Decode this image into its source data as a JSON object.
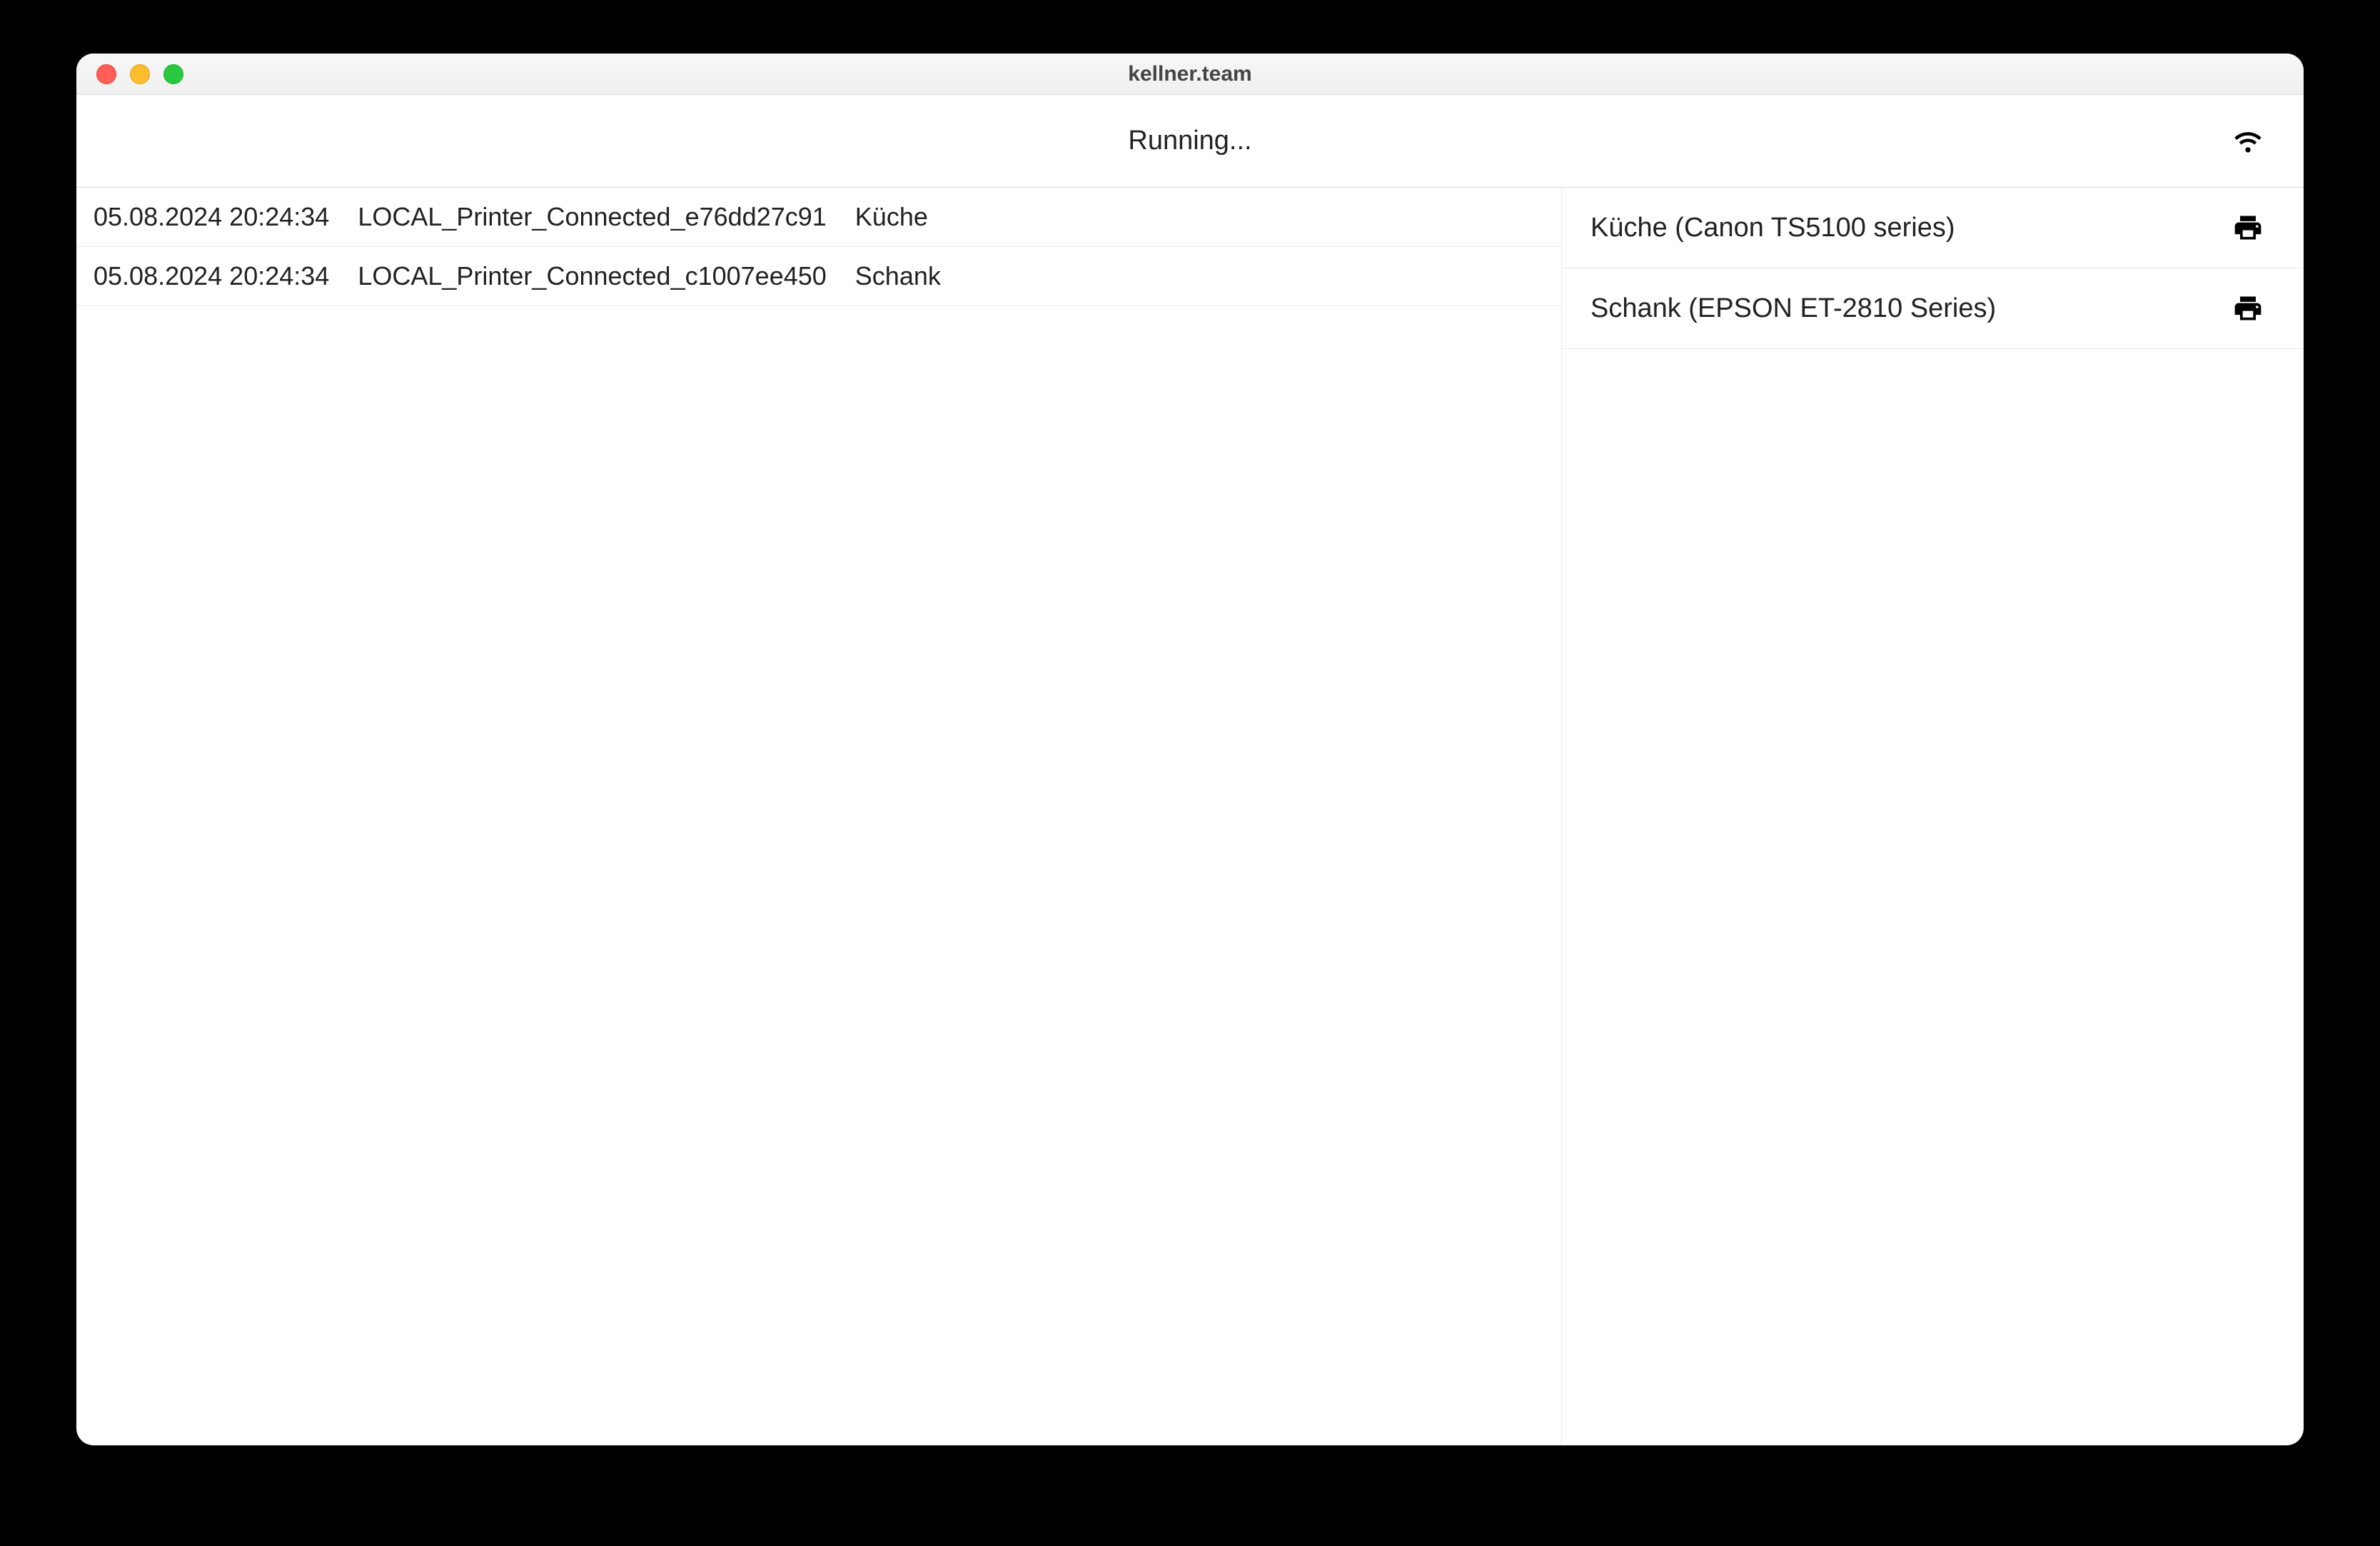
{
  "window": {
    "title": "kellner.team"
  },
  "status": {
    "text": "Running..."
  },
  "log": {
    "rows": [
      {
        "timestamp": "05.08.2024 20:24:34",
        "event": "LOCAL_Printer_Connected_e76dd27c91",
        "detail": "Küche"
      },
      {
        "timestamp": "05.08.2024 20:24:34",
        "event": "LOCAL_Printer_Connected_c1007ee450",
        "detail": "Schank"
      }
    ]
  },
  "printers": {
    "items": [
      {
        "name": "Küche (Canon TS5100 series)"
      },
      {
        "name": "Schank (EPSON ET-2810 Series)"
      }
    ]
  }
}
